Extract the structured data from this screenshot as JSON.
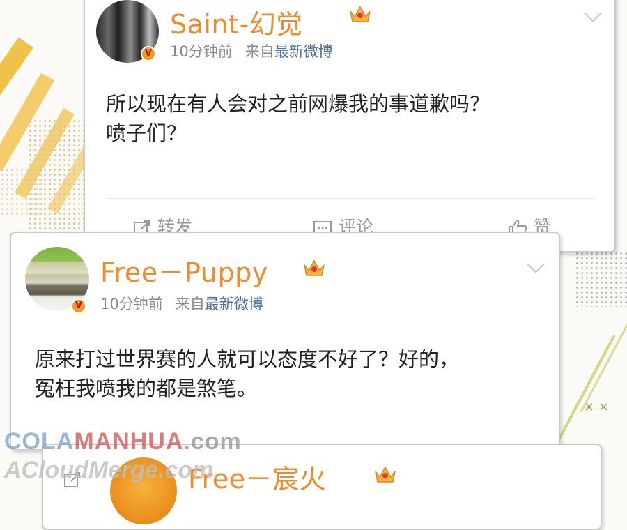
{
  "posts": [
    {
      "username": "Saint-幻觉",
      "time": "10分钟前",
      "source_prefix": "来自",
      "source": "最新微博",
      "text_line1": "所以现在有人会对之前网爆我的事道歉吗？",
      "text_line2": "喷子们？",
      "actions": {
        "repost": "转发",
        "comment": "评论",
        "like": "赞"
      }
    },
    {
      "username": "Free－Puppy",
      "time": "10分钟前",
      "source_prefix": "来自",
      "source": "最新微博",
      "text_line1": "原来打过世界赛的人就可以态度不好了？好的，",
      "text_line2": "冤枉我喷我的都是煞笔。"
    },
    {
      "username": "Free－宸火"
    }
  ],
  "watermark": {
    "line1_part1": "COLA",
    "line1_part2": "MANHUA",
    "line1_part3": ".com",
    "line2": "ACloudMerge.com"
  },
  "colors": {
    "username": "#f08a2a",
    "link": "#4a6fa5",
    "accent_yellow": "#f1c24a"
  }
}
